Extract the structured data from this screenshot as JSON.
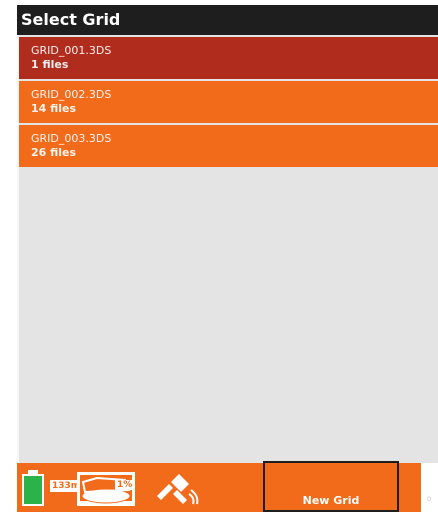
{
  "header": {
    "title": "Select Grid"
  },
  "grids": [
    {
      "name": "GRID_001.3DS",
      "files": "1 files",
      "selected": true
    },
    {
      "name": "GRID_002.3DS",
      "files": "14 files",
      "selected": false
    },
    {
      "name": "GRID_003.3DS",
      "files": "26 files",
      "selected": false
    }
  ],
  "status": {
    "battery_label": "133m",
    "disk_label": "1%",
    "battery_icon": "battery-icon",
    "disk_icon": "disk-icon",
    "satellite_icon": "satellite-icon"
  },
  "actions": {
    "new_grid_label": "New Grid"
  },
  "colors": {
    "accent": "#f26b1a",
    "selected": "#b02d1e",
    "title_bg": "#1e1e1e",
    "list_bg": "#e4e4e4",
    "battery": "#2bb34a"
  }
}
